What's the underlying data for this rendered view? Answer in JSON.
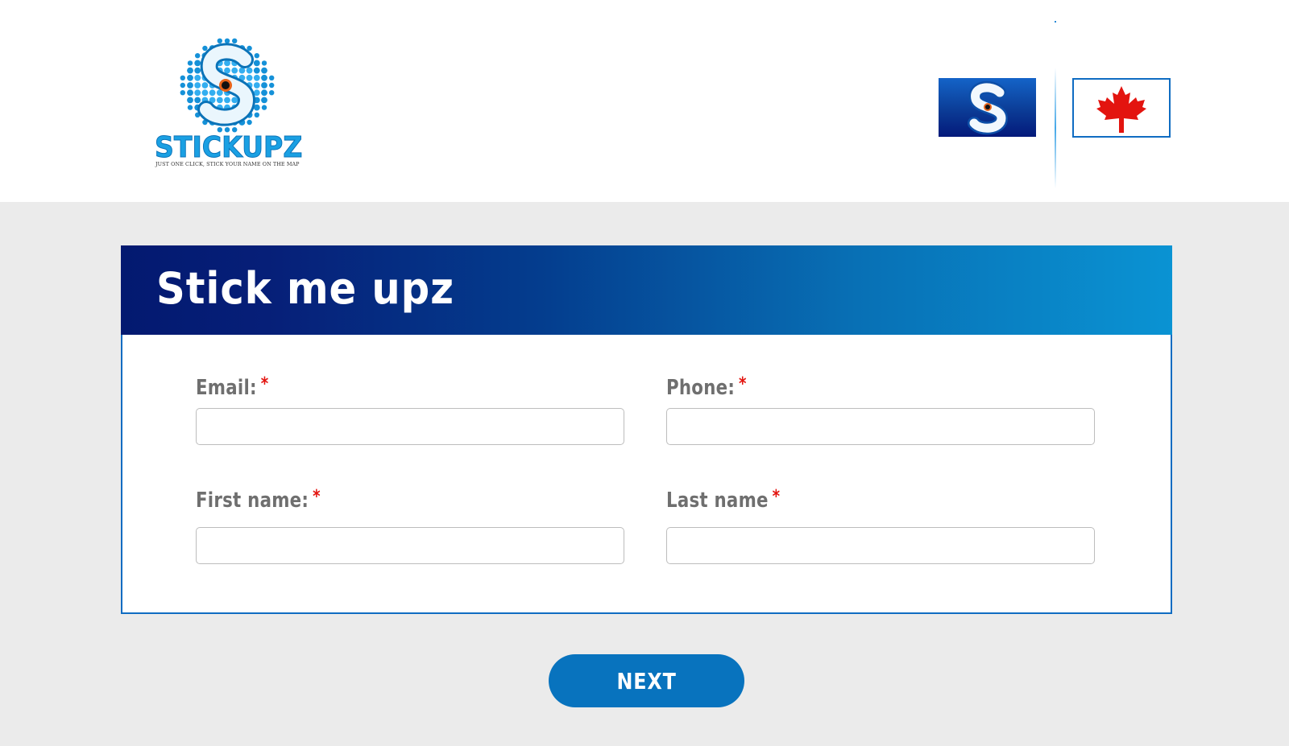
{
  "header": {
    "logo": {
      "wordmark": "STICKUPZ",
      "tagline": "JUST ONE CLICK, STICK YOUR NAME ON THE MAP",
      "icon": "stickupz-logo-icon"
    },
    "brand_tile_icon": "stickupz-s-icon",
    "language_flag_icon": "canada-flag-icon"
  },
  "form": {
    "title": "Stick me upz",
    "required_marker": "*",
    "fields": {
      "email": {
        "label": "Email:",
        "value": "",
        "placeholder": ""
      },
      "phone": {
        "label": "Phone:",
        "value": "",
        "placeholder": ""
      },
      "first_name": {
        "label": "First name:",
        "value": "",
        "placeholder": ""
      },
      "last_name": {
        "label": "Last name",
        "value": "",
        "placeholder": ""
      }
    },
    "next_label": "NEXT"
  },
  "colors": {
    "accent": "#0873be",
    "banner_dark": "#031970",
    "banner_light": "#0a93d3",
    "required": "#e3140f",
    "page_background": "#ebebeb"
  }
}
